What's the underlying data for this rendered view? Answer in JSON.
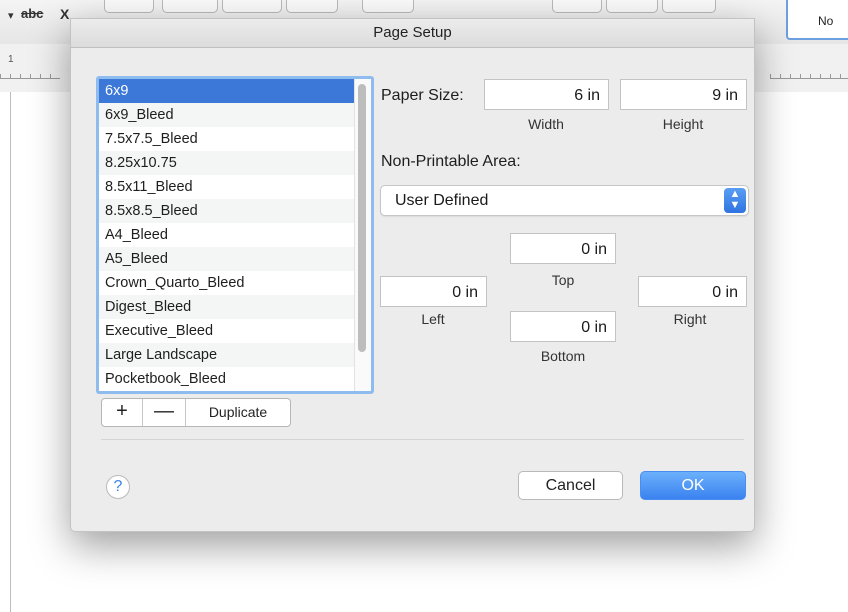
{
  "background": {
    "toolbar_items": [
      "abc",
      "X"
    ],
    "style_box_label": "No",
    "ruler_number": "1"
  },
  "dialog": {
    "title": "Page Setup",
    "paper_list": {
      "items": [
        "6x9",
        "6x9_Bleed",
        "7.5x7.5_Bleed",
        "8.25x10.75",
        "8.5x11_Bleed",
        "8.5x8.5_Bleed",
        "A4_Bleed",
        "A5_Bleed",
        "Crown_Quarto_Bleed",
        "Digest_Bleed",
        "Executive_Bleed",
        "Large Landscape",
        "Pocketbook_Bleed"
      ],
      "selected": "6x9"
    },
    "list_controls": {
      "add_label": "+",
      "remove_label": "—",
      "duplicate_label": "Duplicate"
    },
    "paper_size": {
      "label": "Paper Size:",
      "width_value": "6 in",
      "width_label": "Width",
      "height_value": "9 in",
      "height_label": "Height"
    },
    "non_printable": {
      "label": "Non-Printable Area:",
      "selected_option": "User Defined",
      "top_value": "0 in",
      "top_label": "Top",
      "left_value": "0 in",
      "left_label": "Left",
      "right_value": "0 in",
      "right_label": "Right",
      "bottom_value": "0 in",
      "bottom_label": "Bottom"
    },
    "buttons": {
      "help": "?",
      "cancel": "Cancel",
      "ok": "OK"
    },
    "colors": {
      "selection": "#3b78d8",
      "accent": "#3a82f0",
      "list_focus": "#8fbcef"
    }
  }
}
